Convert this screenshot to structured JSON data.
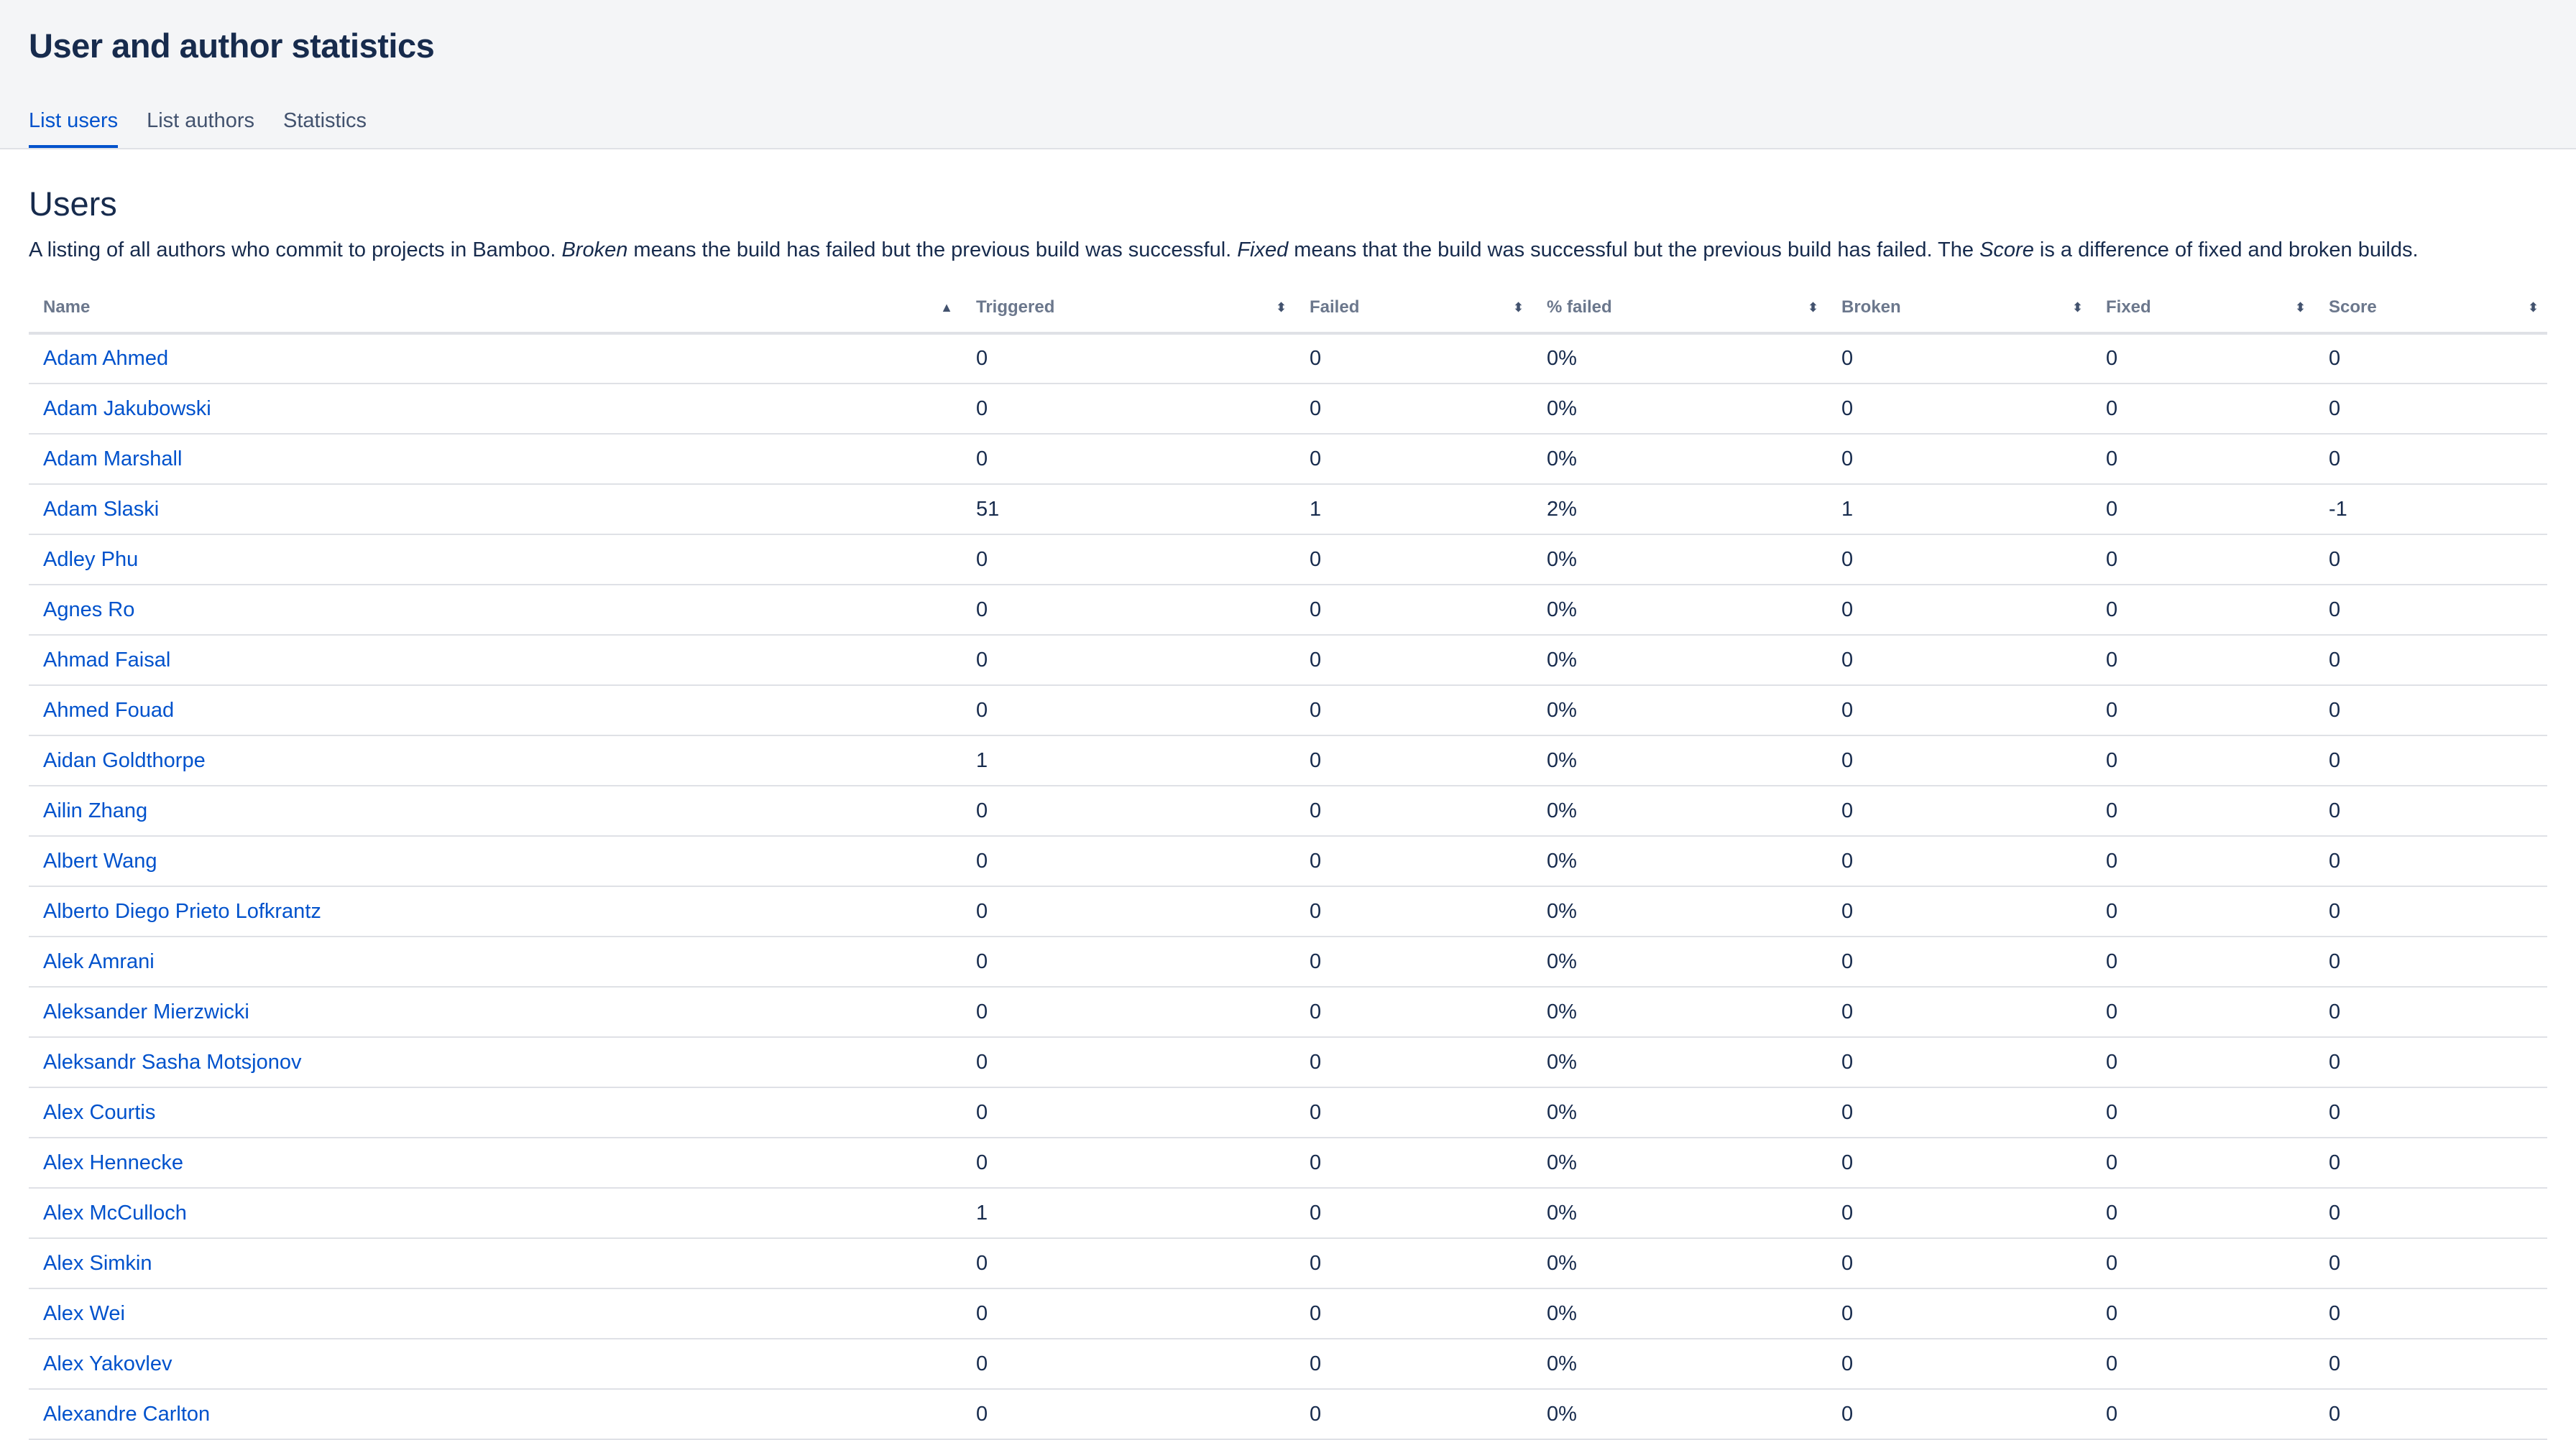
{
  "header": {
    "title": "User and author statistics",
    "tabs": [
      {
        "label": "List users",
        "active": true
      },
      {
        "label": "List authors",
        "active": false
      },
      {
        "label": "Statistics",
        "active": false
      }
    ]
  },
  "main": {
    "title": "Users",
    "description": {
      "part1": "A listing of all authors who commit to projects in Bamboo. ",
      "broken_term": "Broken",
      "part2": " means the build has failed but the previous build was successful. ",
      "fixed_term": "Fixed",
      "part3": " means that the build was successful but the previous build has failed. The ",
      "score_term": "Score",
      "part4": " is a difference of fixed and broken builds."
    },
    "columns": [
      "Name",
      "Triggered",
      "Failed",
      "% failed",
      "Broken",
      "Fixed",
      "Score"
    ],
    "sort_icons": {
      "ascending": "▲",
      "both": "⬍"
    },
    "rows": [
      [
        "Adam Ahmed",
        "0",
        "0",
        "0%",
        "0",
        "0",
        "0"
      ],
      [
        "Adam Jakubowski",
        "0",
        "0",
        "0%",
        "0",
        "0",
        "0"
      ],
      [
        "Adam Marshall",
        "0",
        "0",
        "0%",
        "0",
        "0",
        "0"
      ],
      [
        "Adam Slaski",
        "51",
        "1",
        "2%",
        "1",
        "0",
        "-1"
      ],
      [
        "Adley Phu",
        "0",
        "0",
        "0%",
        "0",
        "0",
        "0"
      ],
      [
        "Agnes Ro",
        "0",
        "0",
        "0%",
        "0",
        "0",
        "0"
      ],
      [
        "Ahmad Faisal",
        "0",
        "0",
        "0%",
        "0",
        "0",
        "0"
      ],
      [
        "Ahmed Fouad",
        "0",
        "0",
        "0%",
        "0",
        "0",
        "0"
      ],
      [
        "Aidan Goldthorpe",
        "1",
        "0",
        "0%",
        "0",
        "0",
        "0"
      ],
      [
        "Ailin Zhang",
        "0",
        "0",
        "0%",
        "0",
        "0",
        "0"
      ],
      [
        "Albert Wang",
        "0",
        "0",
        "0%",
        "0",
        "0",
        "0"
      ],
      [
        "Alberto Diego Prieto Lofkrantz",
        "0",
        "0",
        "0%",
        "0",
        "0",
        "0"
      ],
      [
        "Alek Amrani",
        "0",
        "0",
        "0%",
        "0",
        "0",
        "0"
      ],
      [
        "Aleksander Mierzwicki",
        "0",
        "0",
        "0%",
        "0",
        "0",
        "0"
      ],
      [
        "Aleksandr Sasha Motsjonov",
        "0",
        "0",
        "0%",
        "0",
        "0",
        "0"
      ],
      [
        "Alex Courtis",
        "0",
        "0",
        "0%",
        "0",
        "0",
        "0"
      ],
      [
        "Alex Hennecke",
        "0",
        "0",
        "0%",
        "0",
        "0",
        "0"
      ],
      [
        "Alex McCulloch",
        "1",
        "0",
        "0%",
        "0",
        "0",
        "0"
      ],
      [
        "Alex Simkin",
        "0",
        "0",
        "0%",
        "0",
        "0",
        "0"
      ],
      [
        "Alex Wei",
        "0",
        "0",
        "0%",
        "0",
        "0",
        "0"
      ],
      [
        "Alex Yakovlev",
        "0",
        "0",
        "0%",
        "0",
        "0",
        "0"
      ],
      [
        "Alexandre Carlton",
        "0",
        "0",
        "0%",
        "0",
        "0",
        "0"
      ]
    ]
  },
  "colors": {
    "link": "#0052cc",
    "text": "#172b4d",
    "header_bg": "#f4f5f7",
    "border": "#dfe1e6",
    "muted": "#6b778c"
  }
}
